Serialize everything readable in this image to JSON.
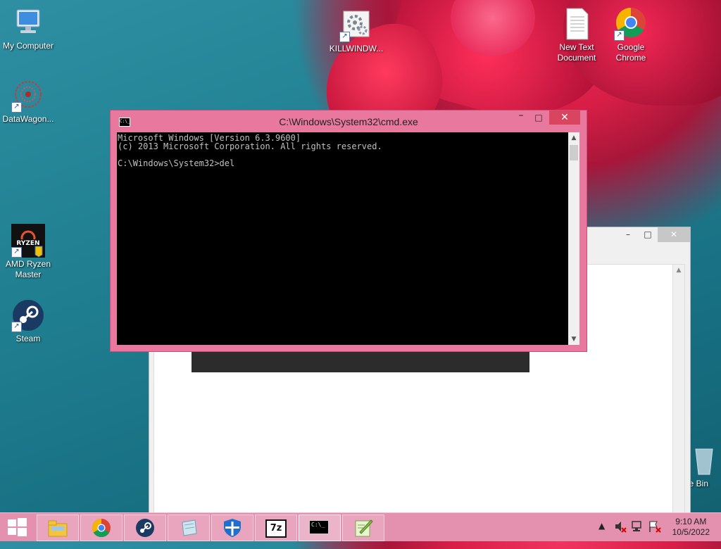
{
  "desktop": {
    "icons": [
      {
        "label": "My Computer"
      },
      {
        "label": "DataWagon..."
      },
      {
        "label": "AMD Ryzen Master"
      },
      {
        "label": "Steam"
      },
      {
        "label": "KILLWINDW..."
      },
      {
        "label": "New Text Document"
      },
      {
        "label": "Google Chrome"
      },
      {
        "label": "e Bin"
      }
    ]
  },
  "cmd": {
    "title": "C:\\Windows\\System32\\cmd.exe",
    "icon_text": "C:\\_",
    "controls": {
      "min": "–",
      "max": "□",
      "close": "✕"
    },
    "console_lines": [
      "Microsoft Windows [Version 6.3.9600]",
      "(c) 2013 Microsoft Corporation. All rights reserved.",
      "",
      "C:\\Windows\\System32>del"
    ]
  },
  "back_window": {
    "controls": {
      "min": "–",
      "max": "□",
      "close": "✕"
    }
  },
  "taskbar": {
    "pinned": [
      "file-explorer-icon",
      "chrome-icon",
      "steam-icon",
      "notepad-icon",
      "defender-icon",
      "7zip-icon",
      "cmd-icon",
      "notepadpp-icon"
    ],
    "labels": {
      "sevenzip": "7z",
      "cmd": "C:\\_"
    },
    "tray": {
      "chevron": "▲"
    },
    "clock": {
      "time": "9:10 AM",
      "date": "10/5/2022"
    }
  }
}
